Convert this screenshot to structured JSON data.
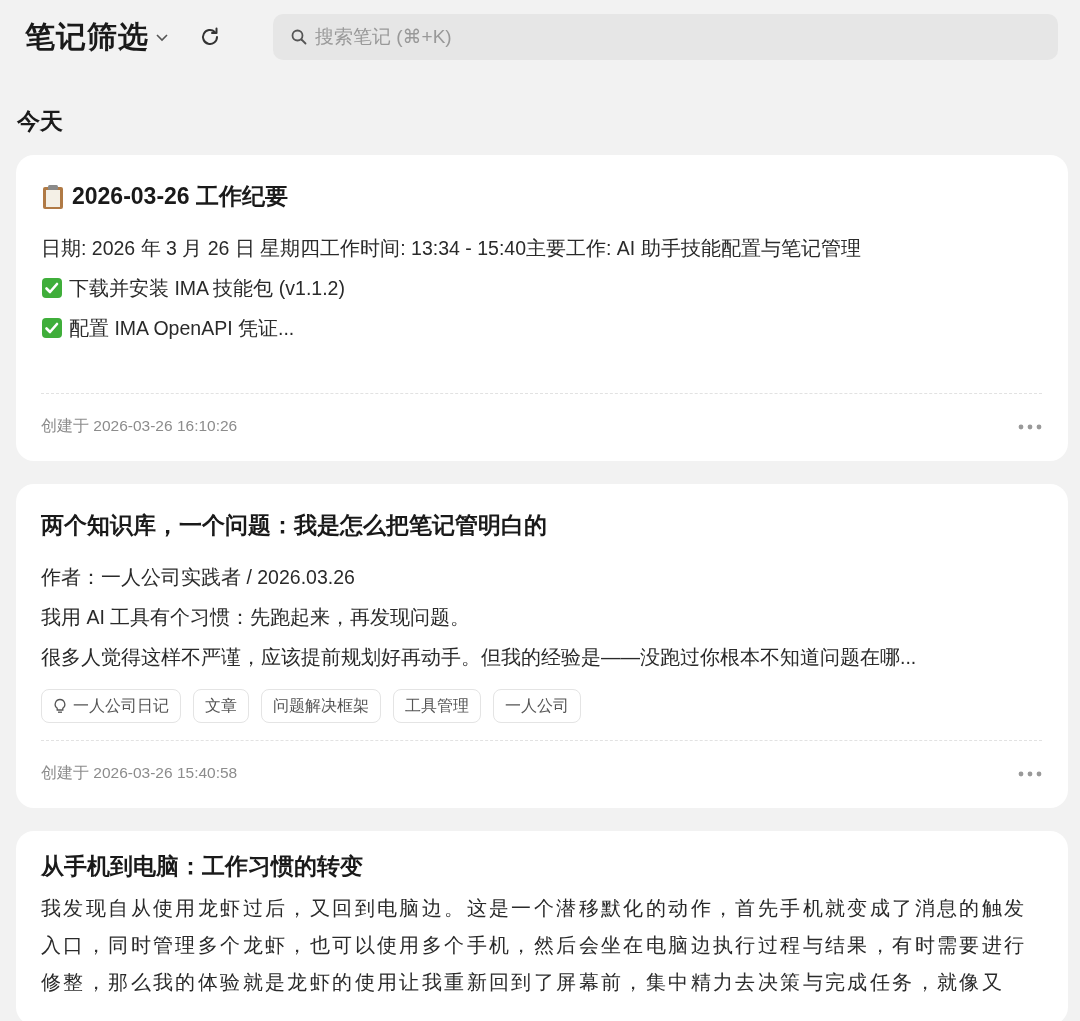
{
  "header": {
    "title": "笔记筛选",
    "search": {
      "placeholder": "搜索笔记 (⌘+K)"
    }
  },
  "sections": [
    {
      "heading": "今天",
      "notes": [
        {
          "title": "2026-03-26 工作纪要",
          "kind": "clipboard",
          "lines": [
            {
              "kind": "plain",
              "text": "日期: 2026 年 3 月 26 日 星期四工作时间: 13:34 - 15:40主要工作: AI 助手技能配置与笔记管理"
            },
            {
              "kind": "done",
              "text": "下载并安装 IMA 技能包 (v1.1.2)"
            },
            {
              "kind": "done",
              "text": "配置 IMA OpenAPI 凭证..."
            }
          ],
          "created": "创建于 2026-03-26 16:10:26"
        },
        {
          "title": "两个知识库，一个问题：我是怎么把笔记管明白的",
          "kind": "plain",
          "lines": [
            {
              "kind": "plain",
              "text": "作者：一人公司实践者 / 2026.03.26"
            },
            {
              "kind": "plain",
              "text": "我用 AI 工具有个习惯：先跑起来，再发现问题。"
            },
            {
              "kind": "plain",
              "text": "很多人觉得这样不严谨，应该提前规划好再动手。但我的经验是——没跑过你根本不知道问题在哪..."
            }
          ],
          "tags": [
            {
              "kind": "idea",
              "label": "一人公司日记"
            },
            {
              "kind": "plain",
              "label": "文章"
            },
            {
              "kind": "plain",
              "label": "问题解决框架"
            },
            {
              "kind": "plain",
              "label": "工具管理"
            },
            {
              "kind": "plain",
              "label": "一人公司"
            }
          ],
          "created": "创建于 2026-03-26 15:40:58"
        },
        {
          "title": "从手机到电脑：工作习惯的转变",
          "kind": "plain",
          "lines": [
            {
              "kind": "paragraph",
              "text": "我发现自从使用龙虾过后，又回到电脑边。这是一个潜移默化的动作，首先手机就变成了消息的触发入口，同时管理多个龙虾，也可以使用多个手机，然后会坐在电脑边执行过程与结果，有时需要进行修整，那么我的体验就是龙虾的使用让我重新回到了屏幕前，集中精力去决策与完成任务，就像又"
            }
          ]
        }
      ]
    }
  ]
}
